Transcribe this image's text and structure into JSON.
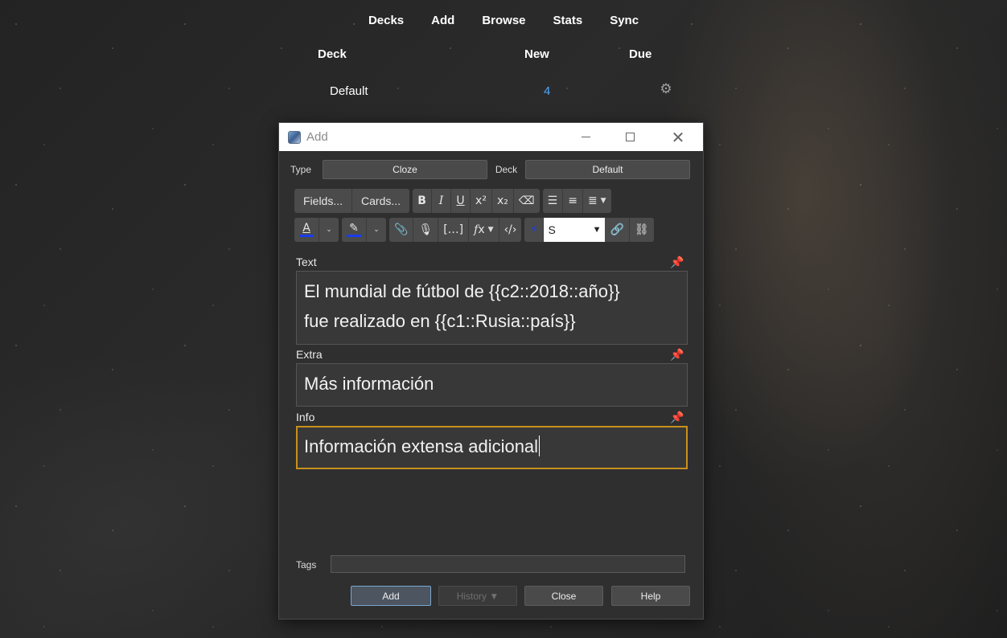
{
  "nav": {
    "items": [
      "Decks",
      "Add",
      "Browse",
      "Stats",
      "Sync"
    ]
  },
  "decks": {
    "headers": {
      "deck": "Deck",
      "new": "New",
      "due": "Due"
    },
    "rows": [
      {
        "name": "Default",
        "new": "4",
        "due": ""
      }
    ],
    "gear_icon": "gear-icon",
    "new_color": "#4da6ff"
  },
  "dialog": {
    "title": "Add",
    "type_label": "Type",
    "type_value": "Cloze",
    "deck_label": "Deck",
    "deck_value": "Default",
    "toolbar": {
      "fields_label": "Fields...",
      "cards_label": "Cards...",
      "font_select_value": "S"
    },
    "fields": [
      {
        "label": "Text",
        "value_line1": "El mundial de fútbol de {{c2::2018::año}}",
        "value_line2": "fue realizado en {{c1::Rusia::país}}"
      },
      {
        "label": "Extra",
        "value": "Más información"
      },
      {
        "label": "Info",
        "value": "Información extensa adicional"
      }
    ],
    "tags_label": "Tags",
    "tags_value": "",
    "buttons": {
      "add": "Add",
      "history": "History ▼",
      "close": "Close",
      "help": "Help"
    },
    "focus_color": "#c8901c"
  }
}
